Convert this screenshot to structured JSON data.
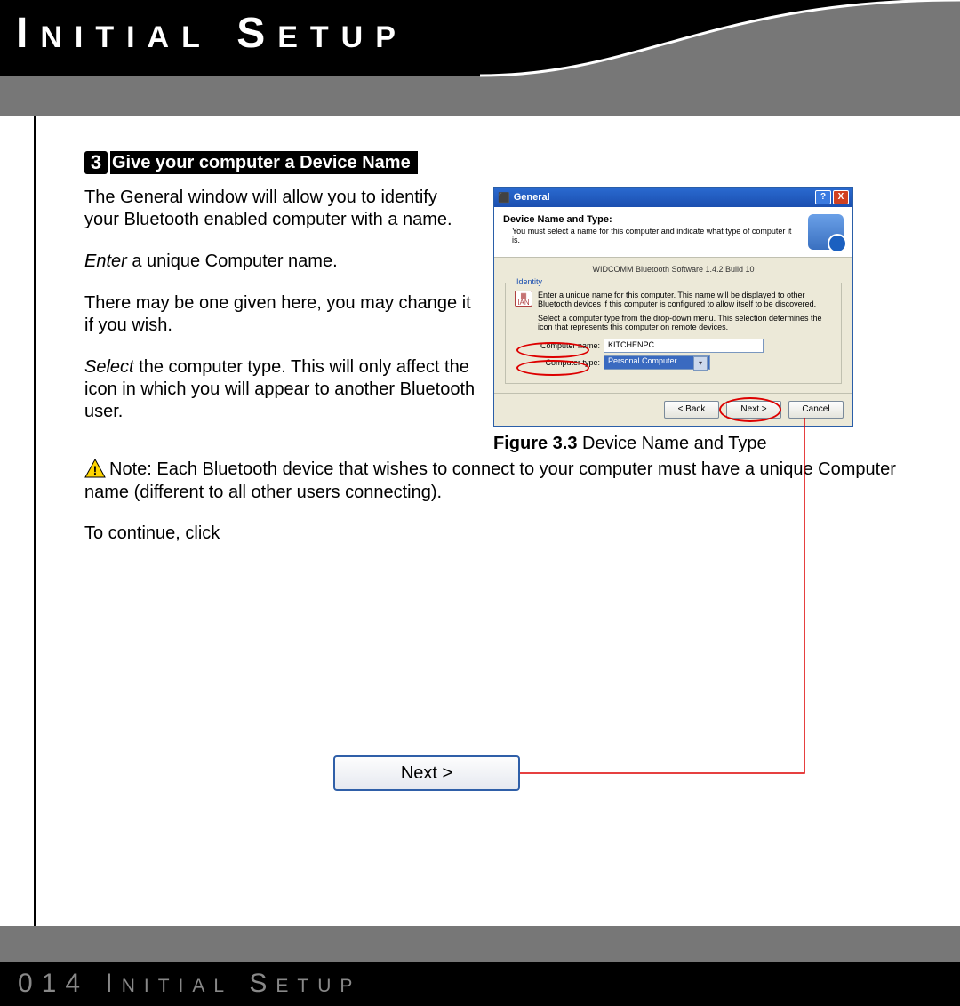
{
  "header": {
    "title": "Initial Setup"
  },
  "step": {
    "number": "3",
    "title": "Give your computer a Device Name"
  },
  "body": {
    "p1": "The General window will allow you to identify your Bluetooth enabled computer with a name.",
    "p2a": "Enter",
    "p2b": " a unique Computer name.",
    "p3": "There may be one given here, you may change it if you wish.",
    "p4a": "Select",
    "p4b": " the computer type. This will only affect the icon in which you will appear to another Bluetooth user.",
    "note": "Note: Each Bluetooth device that wishes to connect to your computer must have a unique Computer name (different to all other users connecting).",
    "continue_a": "To continue, ",
    "continue_b": "click"
  },
  "figure": {
    "caption_bold": "Figure 3.3",
    "caption_rest": " Device Name and Type"
  },
  "dialog": {
    "title": "General",
    "header_title": "Device Name and Type:",
    "header_sub": "You must select a name for this computer and indicate what type of computer it is.",
    "version": "WIDCOMM Bluetooth Software 1.4.2 Build 10",
    "identity_legend": "Identity",
    "identity_text": "Enter a unique name for this computer. This name will be displayed to other Bluetooth devices if this computer is configured to allow itself to be discovered.",
    "identity_text2": "Select a computer type from the drop-down menu. This selection determines the icon that represents this computer on remote devices.",
    "label_name": "Computer name:",
    "value_name": "KITCHENPC",
    "label_type": "Computer type:",
    "value_type": "Personal Computer",
    "btn_back": "< Back",
    "btn_next": "Next >",
    "btn_cancel": "Cancel"
  },
  "big_next": "Next >",
  "footer": {
    "page_number": "014",
    "section": " Initial Setup"
  }
}
